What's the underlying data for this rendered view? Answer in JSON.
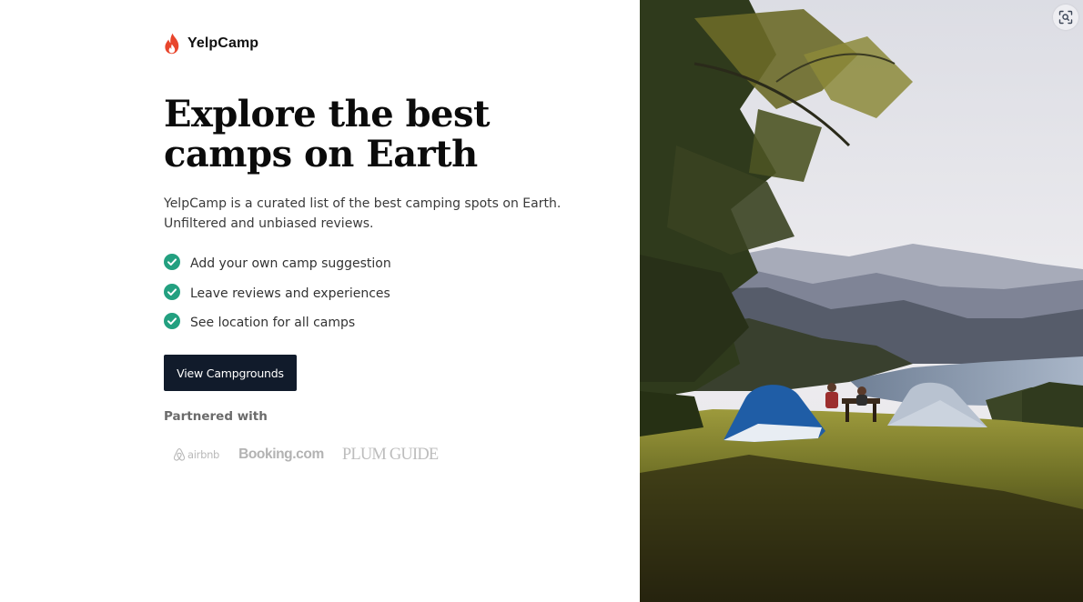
{
  "brand": {
    "name": "YelpCamp",
    "icon": "flame-icon",
    "accent_color": "#e8452c"
  },
  "hero": {
    "headline_lines": [
      "Explore the best",
      "camps on Earth"
    ],
    "description_lines": [
      "YelpCamp is a curated list of the best camping spots on Earth.",
      "Unfiltered and unbiased reviews."
    ]
  },
  "features": {
    "icon": "check-circle-icon",
    "check_color": "#23a080",
    "items": [
      "Add your own camp suggestion",
      "Leave reviews and experiences",
      "See location for all camps"
    ]
  },
  "cta": {
    "label": "View Campgrounds",
    "background": "#111b2b"
  },
  "partners": {
    "heading": "Partnered with",
    "logos": {
      "airbnb": "airbnb",
      "booking": "Booking.com",
      "plum_guide": "PLUM GUIDE"
    }
  },
  "image": {
    "subject": "camping-tents-on-hilltop-photo",
    "lens_button_icon": "visual-search-icon"
  }
}
